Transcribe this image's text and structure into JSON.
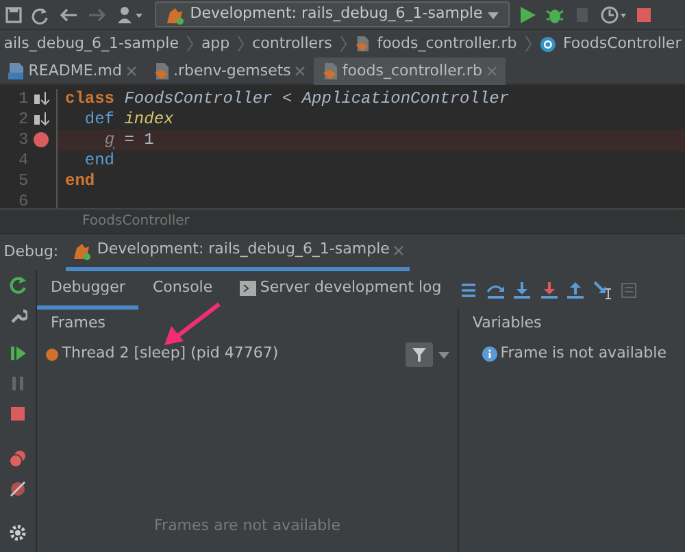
{
  "run_config": {
    "label": "Development: rails_debug_6_1-sample"
  },
  "breadcrumbs": [
    "ails_debug_6_1-sample",
    "app",
    "controllers",
    "foods_controller.rb",
    "FoodsController"
  ],
  "tabs": [
    {
      "label": "README.md",
      "selected": false
    },
    {
      "label": ".rbenv-gemsets",
      "selected": false
    },
    {
      "label": "foods_controller.rb",
      "selected": true
    }
  ],
  "editor": {
    "lines": [
      {
        "number": "1",
        "override_marker": true,
        "breakpoint": false,
        "highlighted": false,
        "tokens": [
          {
            "text": "class ",
            "kind": "keyword"
          },
          {
            "text": "FoodsController < ApplicationController",
            "kind": "type"
          }
        ]
      },
      {
        "number": "2",
        "override_marker": true,
        "breakpoint": false,
        "highlighted": false,
        "tokens": [
          {
            "text": "  def ",
            "kind": "def"
          },
          {
            "text": "index",
            "kind": "method"
          }
        ]
      },
      {
        "number": "3",
        "override_marker": false,
        "breakpoint": true,
        "highlighted": true,
        "tokens": [
          {
            "text": "    g",
            "kind": "unused"
          },
          {
            "text": " = 1",
            "kind": "plain"
          }
        ]
      },
      {
        "number": "4",
        "override_marker": false,
        "breakpoint": false,
        "highlighted": false,
        "tokens": [
          {
            "text": "  end",
            "kind": "def"
          }
        ]
      },
      {
        "number": "5",
        "override_marker": false,
        "breakpoint": false,
        "highlighted": false,
        "tokens": [
          {
            "text": "end",
            "kind": "keyword"
          }
        ]
      },
      {
        "number": "6",
        "override_marker": false,
        "breakpoint": false,
        "highlighted": false
      }
    ],
    "footer_crumb": "FoodsController"
  },
  "debug": {
    "label": "Debug:",
    "session": "Development: rails_debug_6_1-sample",
    "tabs": [
      {
        "label": "Debugger",
        "selected": true
      },
      {
        "label": "Console",
        "selected": false
      },
      {
        "label": "Server development log",
        "selected": false
      }
    ],
    "frames": {
      "title": "Frames",
      "threads": [
        {
          "label": "Thread 2 [sleep] (pid 47767)"
        }
      ],
      "empty": "Frames are not available"
    },
    "variables": {
      "title": "Variables",
      "message": "Frame is not available"
    }
  }
}
